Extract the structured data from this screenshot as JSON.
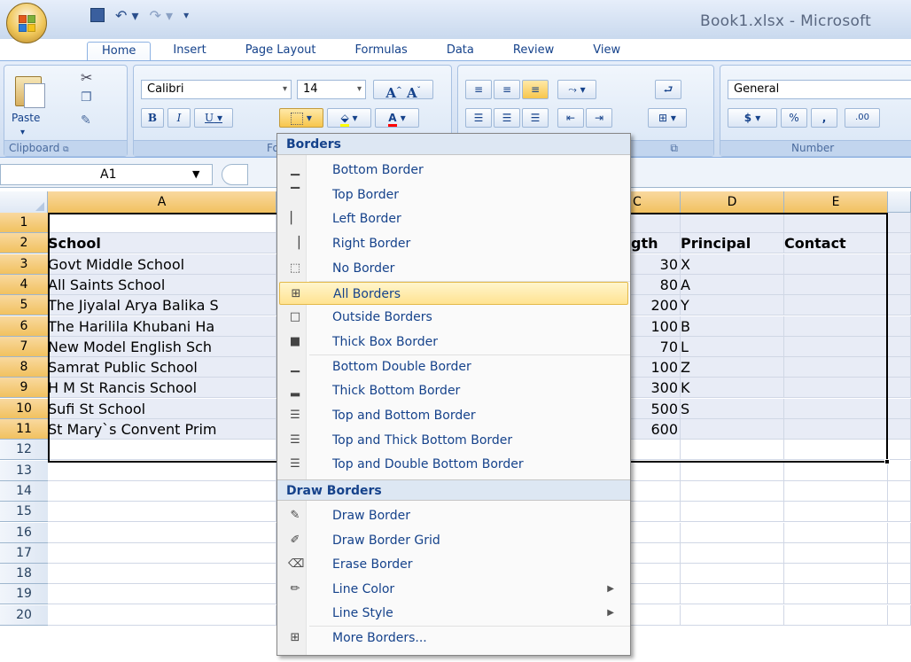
{
  "window": {
    "title": "Book1.xlsx - Microsoft"
  },
  "tabs": [
    "Home",
    "Insert",
    "Page Layout",
    "Formulas",
    "Data",
    "Review",
    "View"
  ],
  "clipboard": {
    "paste": "Paste",
    "group": "Clipboard"
  },
  "font": {
    "name": "Calibri",
    "size": "14",
    "group_partial": "Fo",
    "bold": "B",
    "italic": "I",
    "underline": "U",
    "grow": "A",
    "font_color": "A"
  },
  "number": {
    "format": "General",
    "group": "Number",
    "currency": "$",
    "percent": "%",
    "comma": ",",
    "decimals": ".00"
  },
  "namebox": {
    "value": "A1"
  },
  "columns": [
    "A",
    "",
    "",
    "C",
    "D",
    "E"
  ],
  "rows": [
    "1",
    "2",
    "3",
    "4",
    "5",
    "6",
    "7",
    "8",
    "9",
    "10",
    "11",
    "12",
    "13",
    "14",
    "15",
    "16",
    "17",
    "18",
    "19",
    "20"
  ],
  "sheet": {
    "header": {
      "school": "School",
      "length_partial": "gth",
      "principal": "Principal",
      "contact": "Contact"
    },
    "data": [
      {
        "school": "Govt Middle School",
        "len": "30",
        "principal": "X"
      },
      {
        "school": "All Saints School",
        "len": "80",
        "principal": "A"
      },
      {
        "school": "The Jiyalal Arya Balika S",
        "len": "200",
        "principal": "Y"
      },
      {
        "school": "The Harilila Khubani Ha",
        "len": "100",
        "principal": "B"
      },
      {
        "school": "New Model English Sch",
        "len": "70",
        "principal": "L"
      },
      {
        "school": "Samrat Public School",
        "len": "100",
        "principal": "Z"
      },
      {
        "school": "H M St Rancis School",
        "len": "300",
        "principal": "K"
      },
      {
        "school": "Sufi St School",
        "len": "500",
        "principal": "S"
      },
      {
        "school": "St Mary`s Convent Prim",
        "len": "600",
        "principal": ""
      }
    ]
  },
  "menu": {
    "borders_header": "Borders",
    "items": [
      {
        "label": "Bottom Border",
        "icon": "bottom-border-icon"
      },
      {
        "label": "Top Border",
        "icon": "top-border-icon"
      },
      {
        "label": "Left Border",
        "icon": "left-border-icon"
      },
      {
        "label": "Right Border",
        "icon": "right-border-icon"
      },
      {
        "label": "No Border",
        "icon": "no-border-icon"
      },
      {
        "label": "All Borders",
        "icon": "all-borders-icon"
      },
      {
        "label": "Outside Borders",
        "icon": "outside-borders-icon"
      },
      {
        "label": "Thick Box Border",
        "icon": "thick-box-border-icon"
      },
      {
        "label": "Bottom Double Border",
        "icon": "bottom-double-border-icon"
      },
      {
        "label": "Thick Bottom Border",
        "icon": "thick-bottom-border-icon"
      },
      {
        "label": "Top and Bottom Border",
        "icon": "top-bottom-border-icon"
      },
      {
        "label": "Top and Thick Bottom Border",
        "icon": "top-thick-bottom-border-icon"
      },
      {
        "label": "Top and Double Bottom Border",
        "icon": "top-double-bottom-border-icon"
      }
    ],
    "draw_header": "Draw Borders",
    "draw_items": [
      {
        "label": "Draw Border",
        "icon": "pencil-icon"
      },
      {
        "label": "Draw Border Grid",
        "icon": "pencil-grid-icon"
      },
      {
        "label": "Erase Border",
        "icon": "eraser-icon"
      },
      {
        "label": "Line Color",
        "icon": "line-color-icon"
      },
      {
        "label": "Line Style",
        "icon": ""
      },
      {
        "label": "More Borders...",
        "icon": "more-borders-icon"
      }
    ],
    "active_item": "All Borders"
  },
  "colors": {
    "ribbon": "#dbe6f5",
    "active": "#ffe391",
    "selection": "#e8ecf6",
    "accent": "#15428b"
  }
}
